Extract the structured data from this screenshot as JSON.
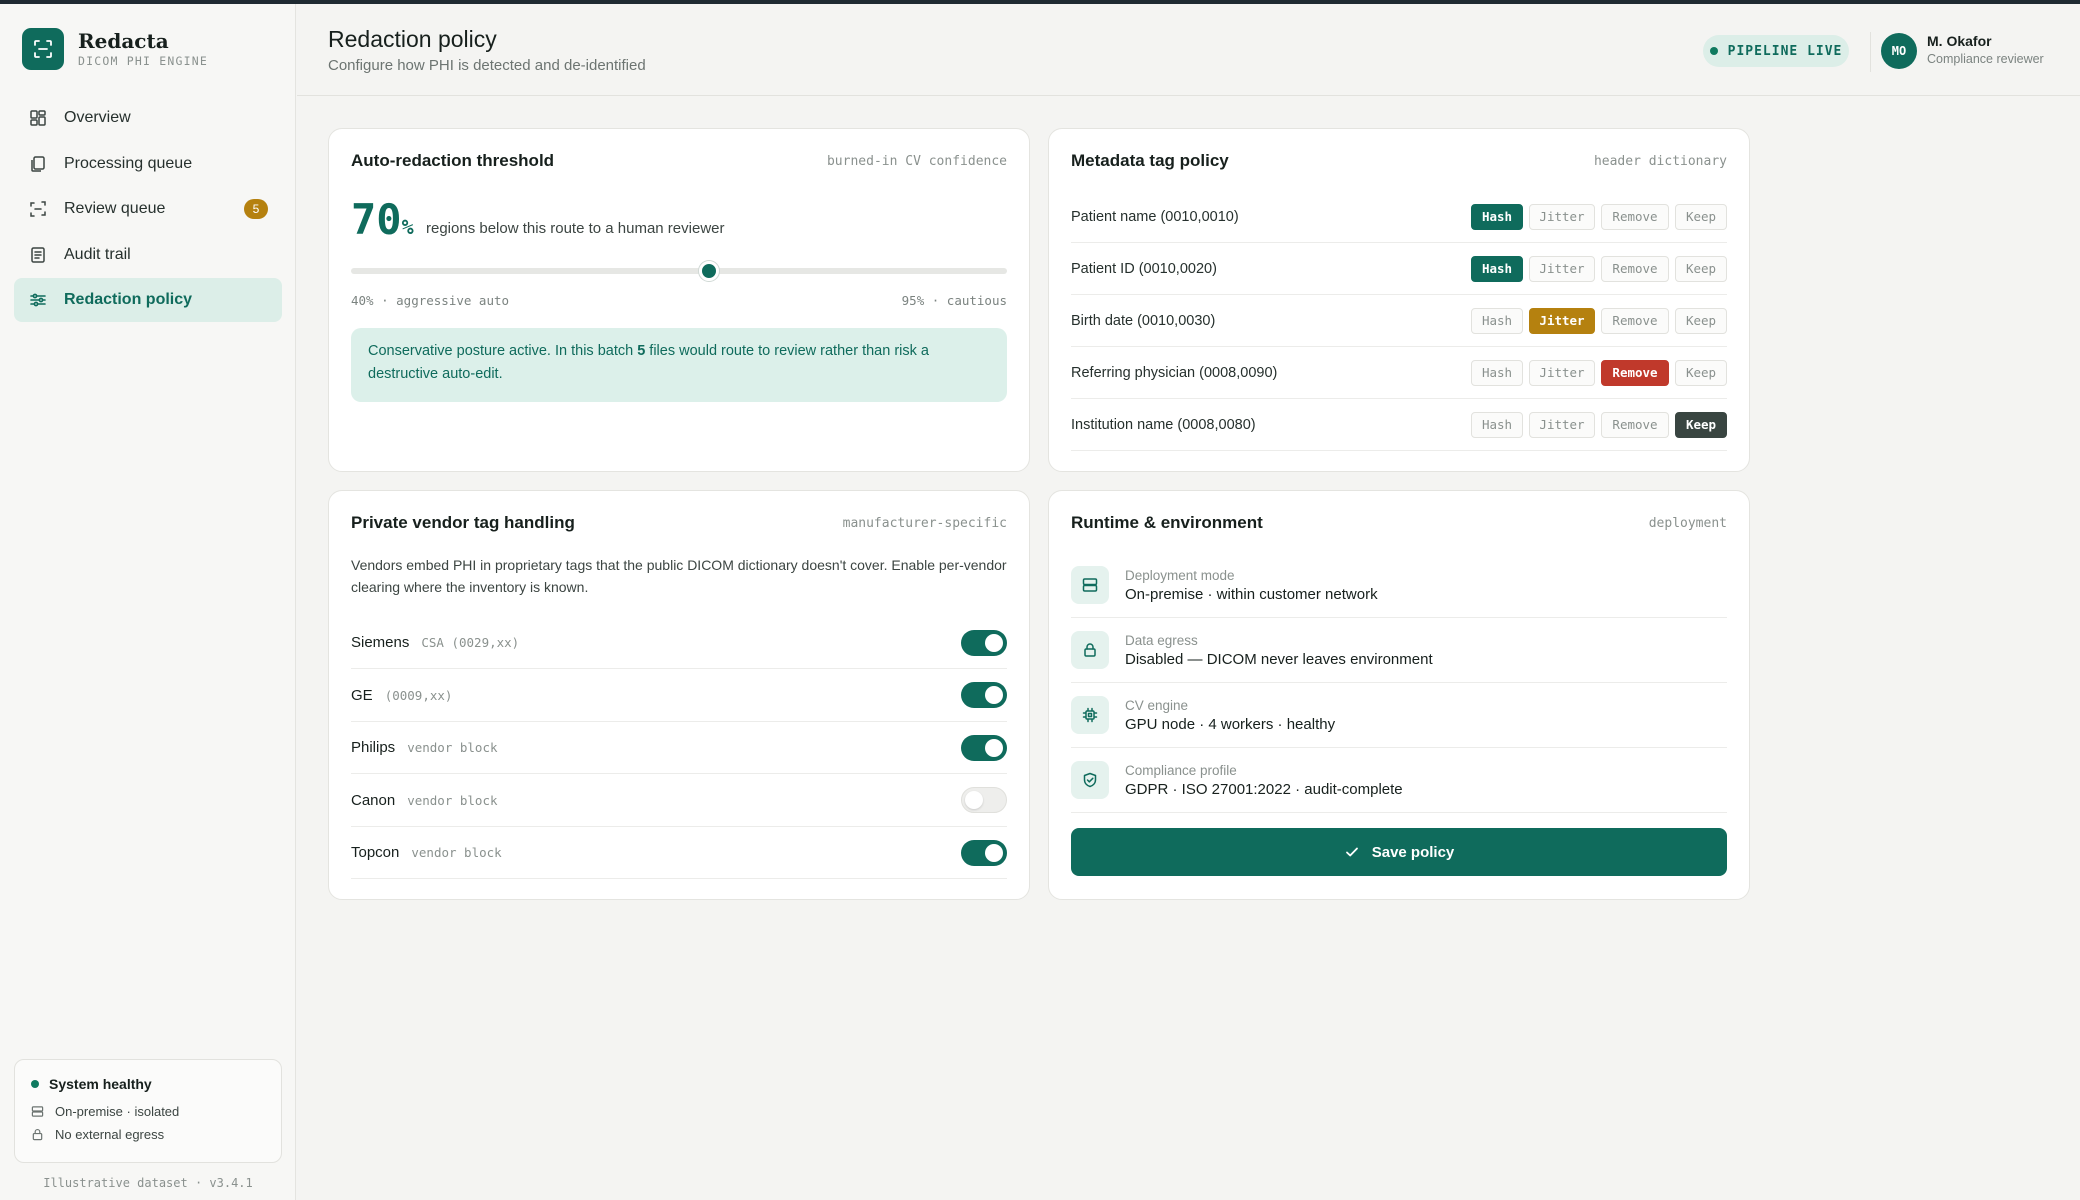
{
  "brand": {
    "name": "Redacta",
    "subtitle": "DICOM PHI ENGINE"
  },
  "nav": [
    {
      "label": "Overview",
      "icon": "grid-icon"
    },
    {
      "label": "Processing queue",
      "icon": "copy-icon"
    },
    {
      "label": "Review queue",
      "icon": "scan-icon",
      "badge": "5"
    },
    {
      "label": "Audit trail",
      "icon": "file-list-icon"
    },
    {
      "label": "Redaction policy",
      "icon": "sliders-icon",
      "active": true
    }
  ],
  "system": {
    "status": "System healthy",
    "deployment": "On-premise · isolated",
    "egress": "No external egress"
  },
  "version": "Illustrative dataset · v3.4.1",
  "header": {
    "title": "Redaction policy",
    "subtitle": "Configure how PHI is detected and de-identified",
    "pipeline_status": "PIPELINE LIVE",
    "user_initials": "MO",
    "user_name": "M. Okafor",
    "user_role": "Compliance reviewer"
  },
  "threshold": {
    "title": "Auto-redaction threshold",
    "tag": "burned-in CV confidence",
    "value": "70",
    "unit": "%",
    "caption": "regions below this route to a human reviewer",
    "slider_value": 0.7,
    "slider_min_value": 0.4,
    "slider_max_value": 0.95,
    "min_label": "40% · aggressive auto",
    "max_label": "95% · cautious",
    "notice_pre": "Conservative posture active. In this batch ",
    "notice_count": "5",
    "notice_post": " files would route to review rather than risk a destructive auto-edit."
  },
  "metadata": {
    "title": "Metadata tag policy",
    "tag": "header dictionary",
    "options": [
      "Hash",
      "Jitter",
      "Remove",
      "Keep"
    ],
    "rows": [
      {
        "label": "Patient name (0010,0010)",
        "selected": "Hash"
      },
      {
        "label": "Patient ID (0010,0020)",
        "selected": "Hash"
      },
      {
        "label": "Birth date (0010,0030)",
        "selected": "Jitter"
      },
      {
        "label": "Referring physician (0008,0090)",
        "selected": "Remove"
      },
      {
        "label": "Institution name (0008,0080)",
        "selected": "Keep"
      }
    ]
  },
  "vendor": {
    "title": "Private vendor tag handling",
    "tag": "manufacturer-specific",
    "description": "Vendors embed PHI in proprietary tags that the public DICOM dictionary doesn't cover. Enable per-vendor clearing where the inventory is known.",
    "rows": [
      {
        "name": "Siemens",
        "block": "CSA (0029,xx)",
        "enabled": true
      },
      {
        "name": "GE",
        "block": "(0009,xx)",
        "enabled": true
      },
      {
        "name": "Philips",
        "block": "vendor block",
        "enabled": true
      },
      {
        "name": "Canon",
        "block": "vendor block",
        "enabled": false
      },
      {
        "name": "Topcon",
        "block": "vendor block",
        "enabled": true
      }
    ]
  },
  "runtime": {
    "title": "Runtime & environment",
    "tag": "deployment",
    "rows": [
      {
        "label": "Deployment mode",
        "value": "On-premise · within customer network",
        "icon": "server-icon"
      },
      {
        "label": "Data egress",
        "value": "Disabled — DICOM never leaves environment",
        "icon": "lock-icon"
      },
      {
        "label": "CV engine",
        "value": "GPU node · 4 workers · healthy",
        "icon": "cpu-icon"
      },
      {
        "label": "Compliance profile",
        "value": "GDPR · ISO 27001:2022 · audit-complete",
        "icon": "shield-check-icon"
      }
    ],
    "save_label": "Save policy"
  },
  "colors": {
    "brand": "#0f6b5c",
    "jitter": "#b5810f",
    "remove": "#c0392b",
    "keep": "#394541",
    "notice_bg": "#dcf0ea"
  }
}
